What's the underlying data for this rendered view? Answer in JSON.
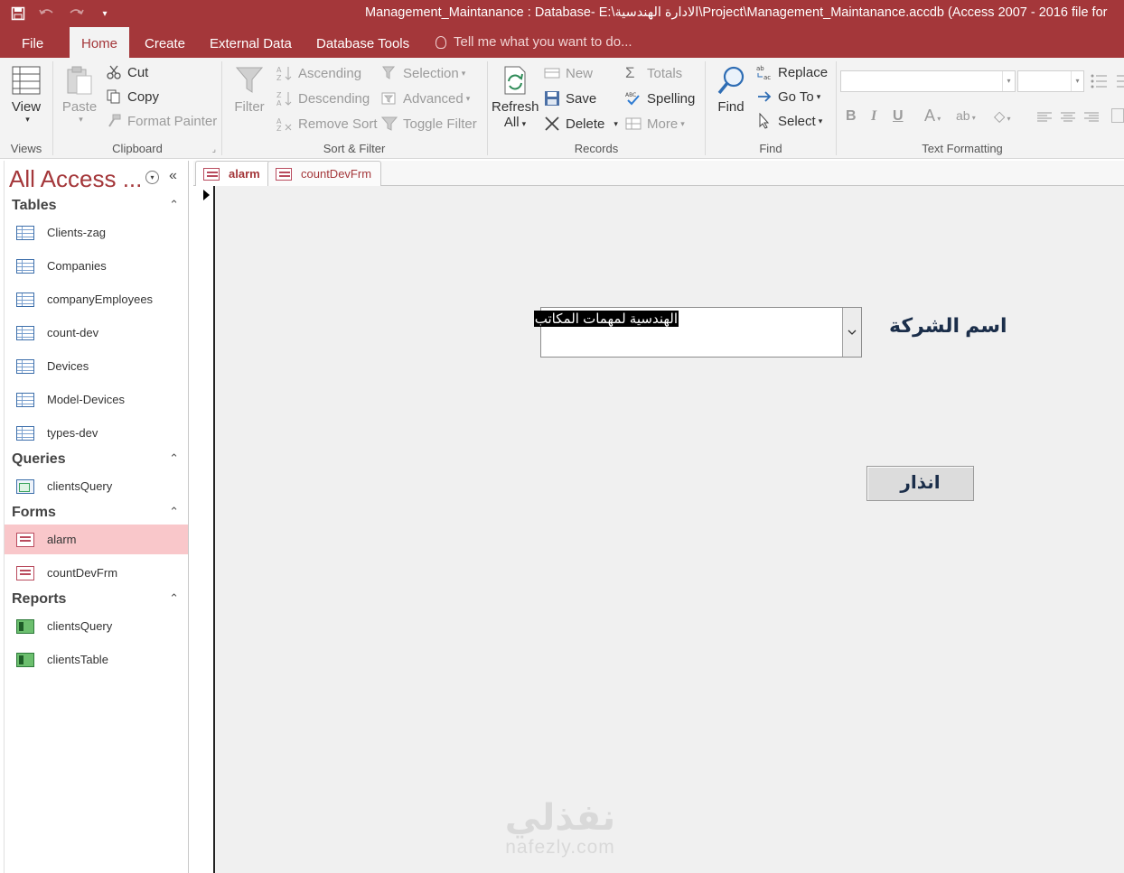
{
  "window": {
    "title": "Management_Maintanance : Database- E:\\الادارة الهندسية\\Project\\Management_Maintanance.accdb (Access 2007 - 2016 file for"
  },
  "ribbon_tabs": [
    {
      "label": "File"
    },
    {
      "label": "Home"
    },
    {
      "label": "Create"
    },
    {
      "label": "External Data"
    },
    {
      "label": "Database Tools"
    }
  ],
  "tell_me": "Tell me what you want to do...",
  "groups": {
    "views": {
      "label": "Views",
      "view": "View"
    },
    "clipboard": {
      "label": "Clipboard",
      "paste": "Paste",
      "cut": "Cut",
      "copy": "Copy",
      "format_painter": "Format Painter"
    },
    "sort_filter": {
      "label": "Sort & Filter",
      "filter": "Filter",
      "ascending": "Ascending",
      "descending": "Descending",
      "remove_sort": "Remove Sort",
      "selection": "Selection",
      "advanced": "Advanced",
      "toggle_filter": "Toggle Filter"
    },
    "records": {
      "label": "Records",
      "refresh_all": "Refresh",
      "refresh_all_2": "All",
      "new": "New",
      "save": "Save",
      "delete": "Delete",
      "totals": "Totals",
      "spelling": "Spelling",
      "more": "More"
    },
    "find": {
      "label": "Find",
      "find": "Find",
      "replace": "Replace",
      "go_to": "Go To",
      "select": "Select"
    },
    "text_formatting": {
      "label": "Text Formatting"
    }
  },
  "nav": {
    "title": "All Access ...",
    "sections": [
      {
        "label": "Tables",
        "items": [
          "Clients-zag",
          "Companies",
          "companyEmployees",
          "count-dev",
          "Devices",
          "Model-Devices",
          "types-dev"
        ]
      },
      {
        "label": "Queries",
        "items": [
          "clientsQuery"
        ]
      },
      {
        "label": "Forms",
        "items": [
          "alarm",
          "countDevFrm"
        ]
      },
      {
        "label": "Reports",
        "items": [
          "clientsQuery",
          "clientsTable"
        ]
      }
    ]
  },
  "doc_tabs": [
    {
      "label": "alarm"
    },
    {
      "label": "countDevFrm"
    }
  ],
  "form": {
    "company_label": "اسم الشركة",
    "company_value": "الهندسية لمهمات المكاتب",
    "alarm_button": "انذار"
  },
  "watermark": {
    "ar": "نفذلي",
    "en": "nafezly.com"
  }
}
